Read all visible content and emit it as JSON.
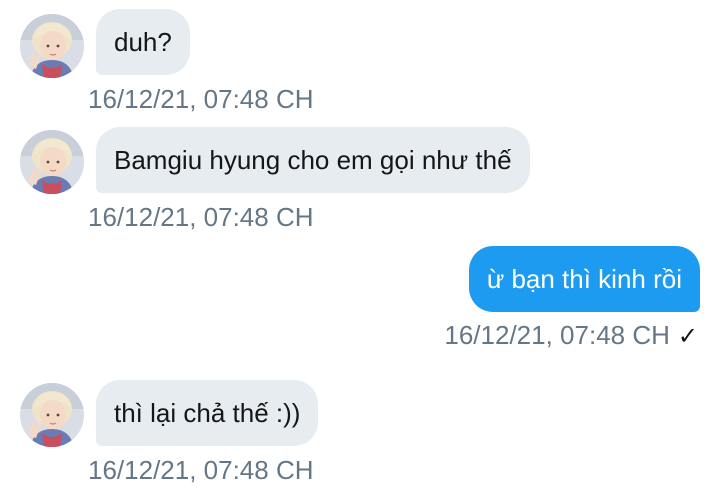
{
  "messages": [
    {
      "direction": "incoming",
      "text": "duh?",
      "timestamp": "16/12/21, 07:48 CH"
    },
    {
      "direction": "incoming",
      "text": "Bamgiu hyung cho em gọi như thế",
      "timestamp": "16/12/21, 07:48 CH"
    },
    {
      "direction": "outgoing",
      "text": "ừ bạn thì kinh rồi",
      "timestamp": "16/12/21, 07:48 CH",
      "status_icon": "check-icon"
    },
    {
      "direction": "incoming",
      "text": "thì lại chả thế :))",
      "timestamp": "16/12/21, 07:48 CH"
    }
  ],
  "colors": {
    "incoming_bubble": "#e6ecf0",
    "outgoing_bubble": "#1d9bf0",
    "timestamp": "#657786"
  }
}
